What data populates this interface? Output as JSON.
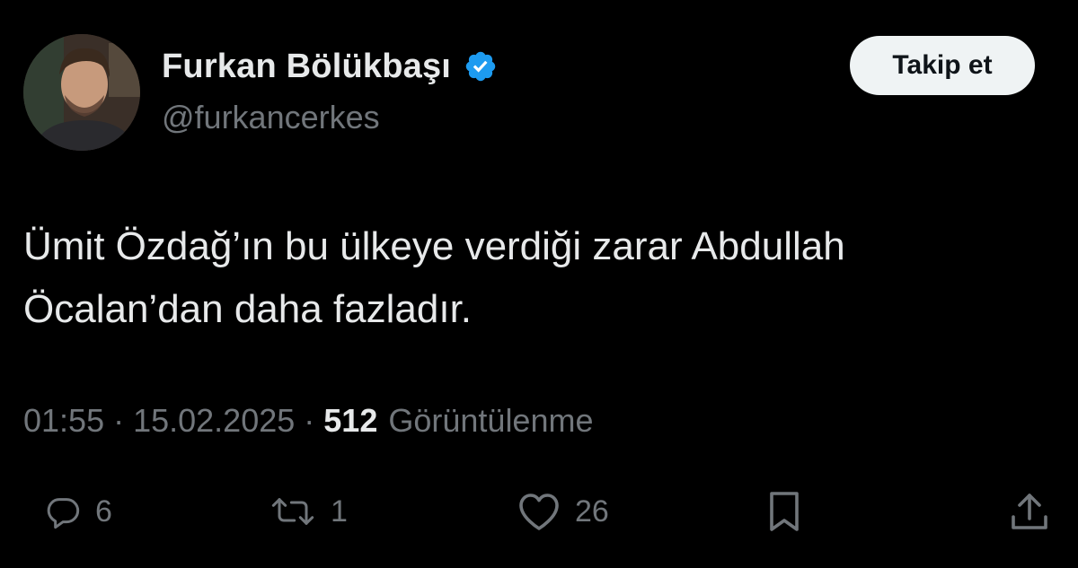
{
  "user": {
    "display_name": "Furkan Bölükbaşı",
    "handle": "@furkancerkes",
    "verified": true,
    "verified_color": "#1d9bf0"
  },
  "follow_button": {
    "label": "Takip et"
  },
  "tweet": {
    "text": "Ümit Özdağ’ın bu ülkeye verdiği zarar Abdullah\nÖcalan’dan daha fazladır.",
    "time": "01:55",
    "date": "15.02.2025",
    "separator": "·",
    "views_count": "512",
    "views_label": "Görüntülenme"
  },
  "actions": {
    "reply": {
      "icon": "reply-icon",
      "count": "6"
    },
    "retweet": {
      "icon": "retweet-icon",
      "count": "1"
    },
    "like": {
      "icon": "heart-icon",
      "count": "26"
    },
    "bookmark": {
      "icon": "bookmark-icon"
    },
    "share": {
      "icon": "share-icon"
    }
  },
  "colors": {
    "background": "#000000",
    "primary_text": "#e7e9ea",
    "secondary_text": "#71767b",
    "button_bg": "#eff3f4"
  }
}
